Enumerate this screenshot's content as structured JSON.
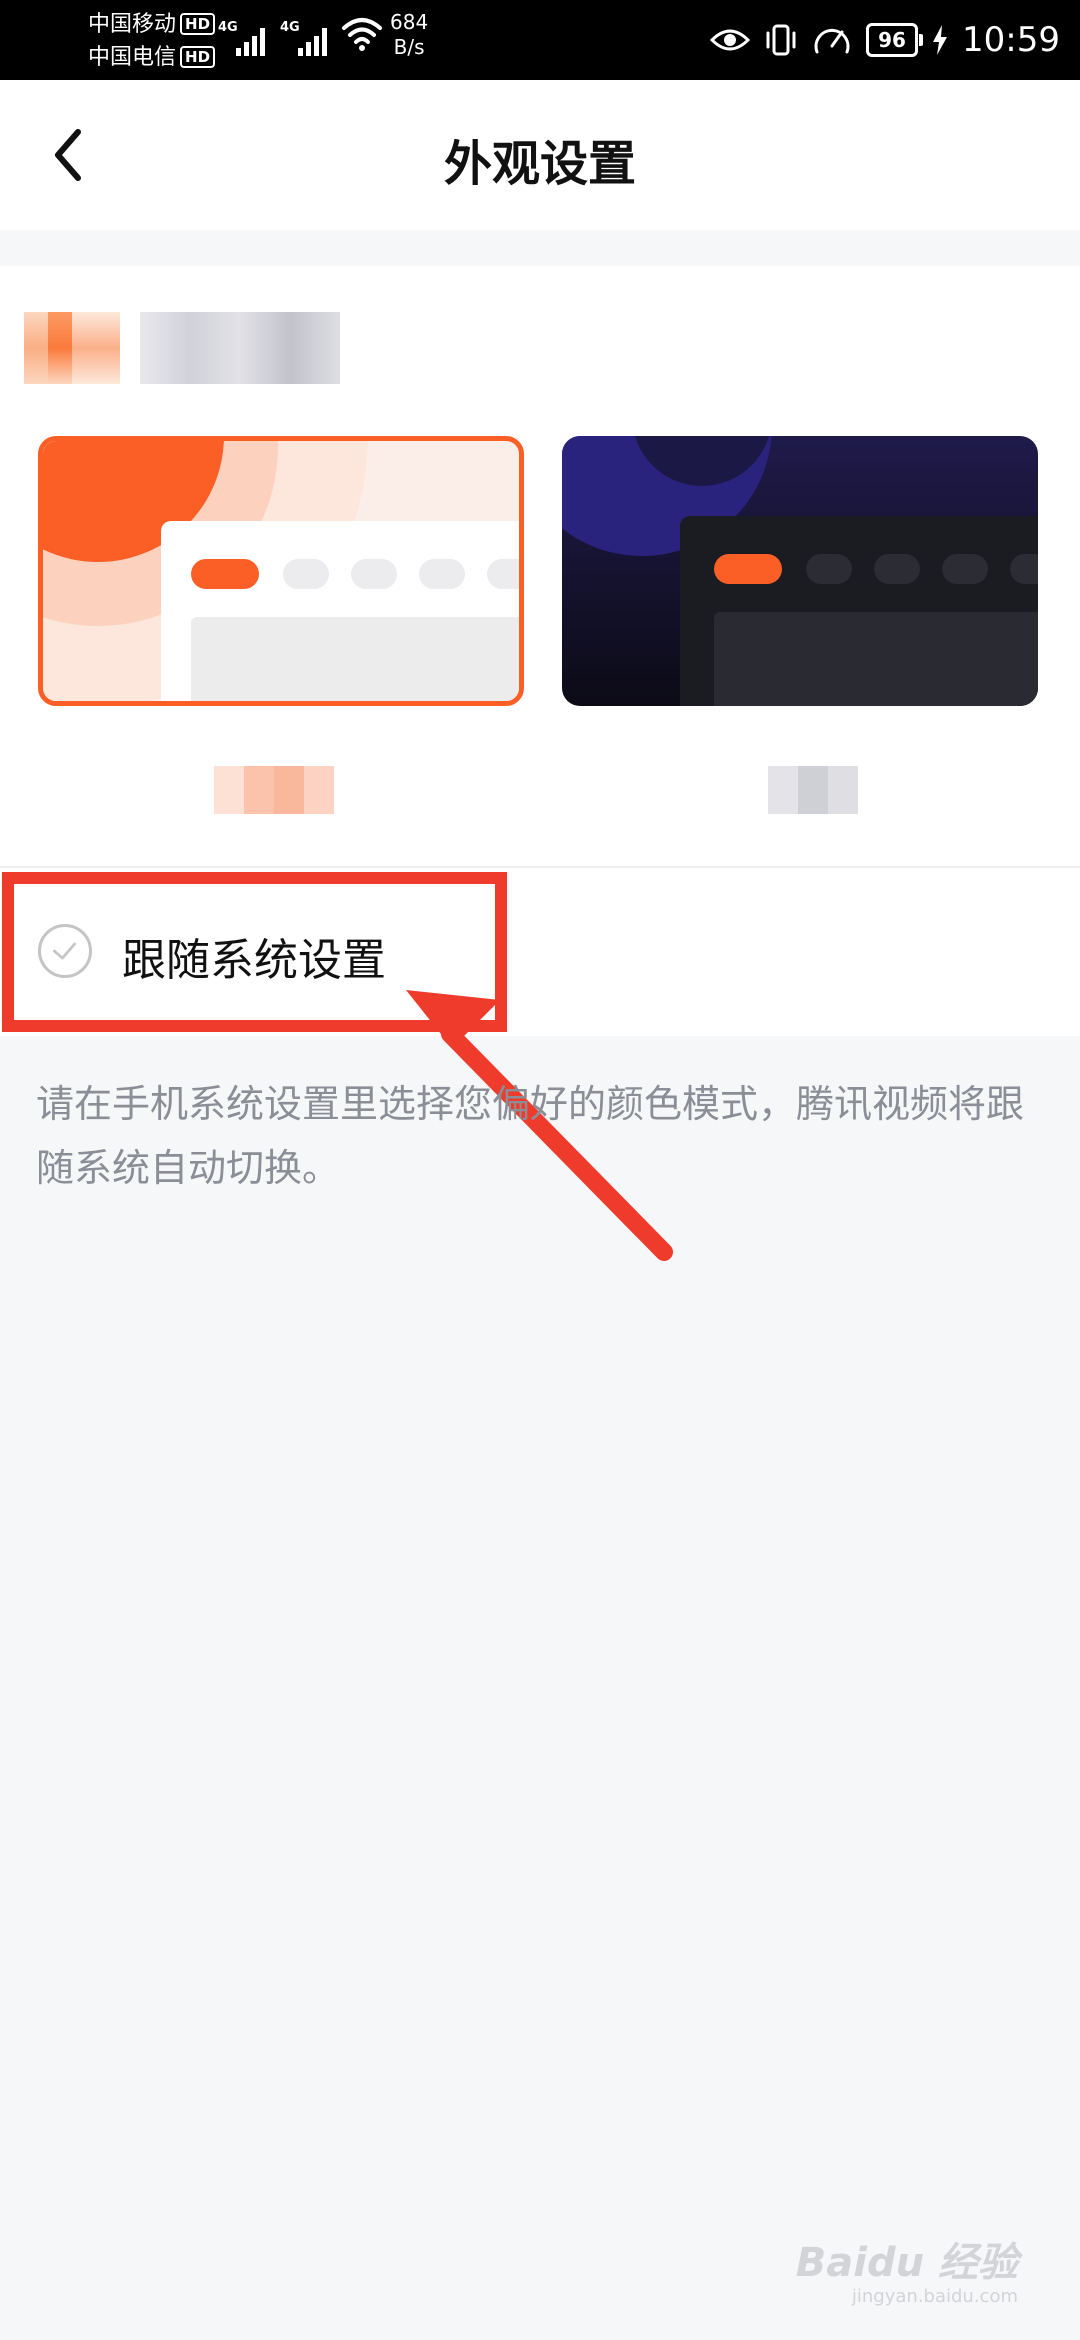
{
  "status_bar": {
    "carrier_1": "中国移动",
    "carrier_2": "中国电信",
    "hd_badge": "HD",
    "network_type": "4G",
    "speed_value": "684",
    "speed_unit": "B/s",
    "battery": "96",
    "time": "10:59"
  },
  "header": {
    "title": "外观设置",
    "back_icon": "chevron-left-icon"
  },
  "theme_options": {
    "light_selected": true,
    "accent_color": "#fb5f26"
  },
  "follow_system": {
    "label": "跟随系统设置",
    "checked": false
  },
  "description": "请在手机系统设置里选择您偏好的颜色模式，腾讯视频将跟随系统自动切换。",
  "watermark": {
    "brand": "Baidu 经验",
    "url": "jingyan.baidu.com"
  },
  "colors": {
    "accent": "#fb5f26",
    "annotation": "#ef3b2c",
    "page_bg": "#f6f7f9"
  }
}
